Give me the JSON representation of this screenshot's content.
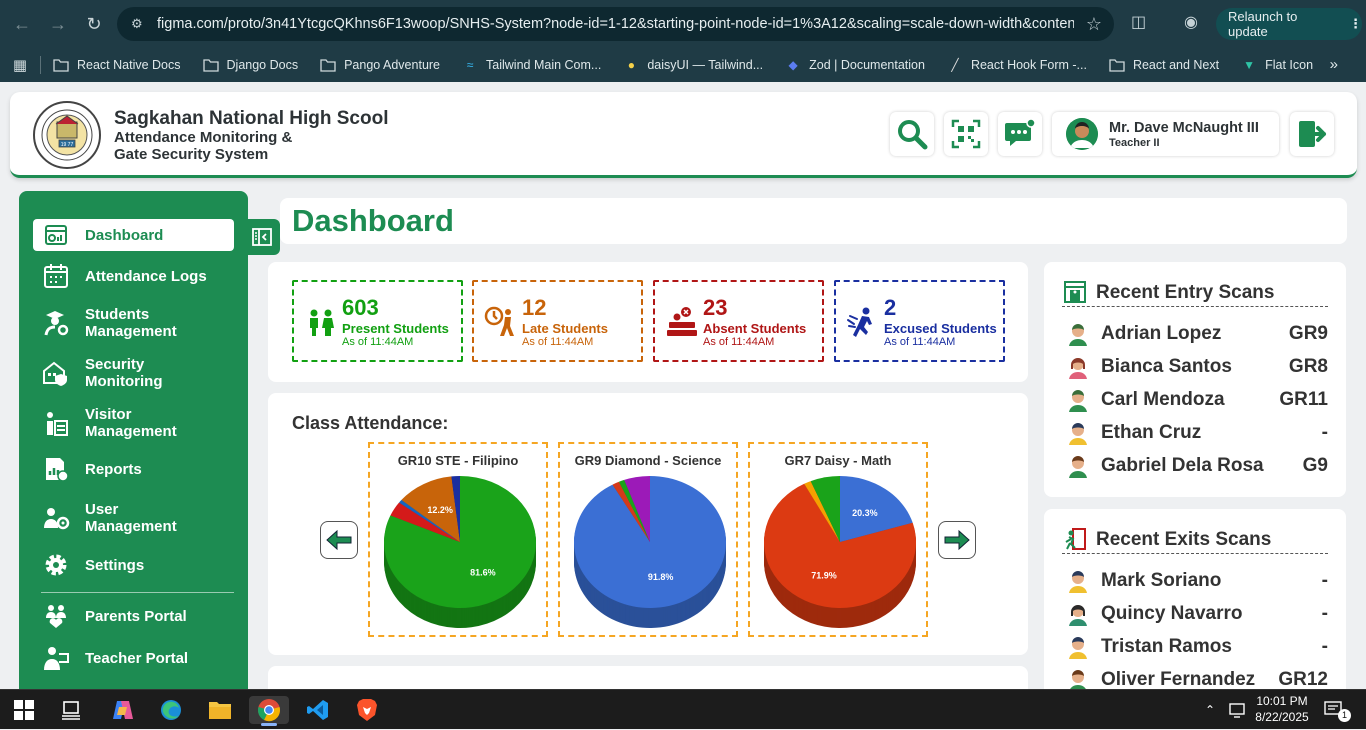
{
  "browser": {
    "url": "figma.com/proto/3n41YtcgcQKhns6F13woop/SNHS-System?node-id=1-12&starting-point-node-id=1%3A12&scaling=scale-down-width&conten...",
    "relaunch_label": "Relaunch to update",
    "bookmarks": [
      {
        "label": "React Native Docs",
        "icon": "folder-icon"
      },
      {
        "label": "Django Docs",
        "icon": "folder-icon"
      },
      {
        "label": "Pango Adventure",
        "icon": "folder-icon"
      },
      {
        "label": "Tailwind Main Com...",
        "icon": "tailwind-icon"
      },
      {
        "label": "daisyUI — Tailwind...",
        "icon": "daisyui-icon"
      },
      {
        "label": "Zod | Documentation",
        "icon": "zod-icon"
      },
      {
        "label": "React Hook Form -...",
        "icon": "rhf-icon"
      },
      {
        "label": "React and Next",
        "icon": "folder-icon"
      },
      {
        "label": "Flat Icon",
        "icon": "flaticon-icon"
      }
    ]
  },
  "header": {
    "school_name": "Sagkahan National High Scool",
    "system_line1": "Attendance Monitoring &",
    "system_line2": "Gate Security System",
    "user_name": "Mr. Dave McNaught III",
    "user_role": "Teacher II"
  },
  "sidebar": {
    "items": [
      {
        "label": "Dashboard",
        "icon": "dashboard-icon"
      },
      {
        "label": "Attendance Logs",
        "icon": "calendar-icon"
      },
      {
        "label": "Students Management",
        "icon": "student-gear-icon"
      },
      {
        "label": "Security Monitoring",
        "icon": "building-shield-icon"
      },
      {
        "label": "Visitor Management",
        "icon": "visitor-icon"
      },
      {
        "label": "Reports",
        "icon": "reports-icon"
      },
      {
        "label": "User Management",
        "icon": "users-gear-icon"
      },
      {
        "label": "Settings",
        "icon": "gear-icon"
      },
      {
        "label": "Parents Portal",
        "icon": "parents-icon"
      },
      {
        "label": "Teacher Portal",
        "icon": "teacher-icon"
      }
    ]
  },
  "main": {
    "page_title": "Dashboard",
    "stats": [
      {
        "value": "603",
        "label": "Present Students",
        "asof": "As of 11:44AM",
        "color": "#12a012"
      },
      {
        "value": "12",
        "label": "Late Students",
        "asof": "As of 11:44AM",
        "color": "#c8640a"
      },
      {
        "value": "23",
        "label": "Absent Students",
        "asof": "As of 11:44AM",
        "color": "#b01616"
      },
      {
        "value": "2",
        "label": "Excused Students",
        "asof": "As of 11:44AM",
        "color": "#1a2fa0"
      }
    ],
    "class_attendance_title": "Class Attendance:"
  },
  "chart_data": [
    {
      "type": "pie",
      "title": "GR10 STE - Filipino",
      "slices": [
        {
          "value": 81.6,
          "label": "81.6%",
          "color": "#1aa31a"
        },
        {
          "value": 3.6,
          "label": "",
          "color": "#d41a1a"
        },
        {
          "value": 0.8,
          "label": "",
          "color": "#1565c0"
        },
        {
          "value": 12.2,
          "label": "12.2%",
          "color": "#c8640a"
        },
        {
          "value": 1.8,
          "label": "",
          "color": "#1a2fa0"
        }
      ]
    },
    {
      "type": "pie",
      "title": "GR9 Diamond - Science",
      "slices": [
        {
          "value": 91.8,
          "label": "91.8%",
          "color": "#3b6fd4"
        },
        {
          "value": 1.5,
          "label": "",
          "color": "#d43a1a"
        },
        {
          "value": 1.2,
          "label": "",
          "color": "#1aa31a"
        },
        {
          "value": 5.5,
          "label": "",
          "color": "#9c1ab8"
        }
      ]
    },
    {
      "type": "pie",
      "title": "GR7 Daisy - Math",
      "slices": [
        {
          "value": 20.3,
          "label": "20.3%",
          "color": "#3b6fd4"
        },
        {
          "value": 71.9,
          "label": "71.9%",
          "color": "#dc3a12"
        },
        {
          "value": 1.5,
          "label": "",
          "color": "#f5a000"
        },
        {
          "value": 6.3,
          "label": "",
          "color": "#1aa31a"
        }
      ]
    }
  ],
  "entry_scans": {
    "title": "Recent Entry Scans",
    "rows": [
      {
        "name": "Adrian Lopez",
        "grade": "GR9"
      },
      {
        "name": "Bianca Santos",
        "grade": "GR8"
      },
      {
        "name": "Carl Mendoza",
        "grade": "GR11"
      },
      {
        "name": "Ethan Cruz",
        "grade": "-"
      },
      {
        "name": "Gabriel Dela Rosa",
        "grade": "G9"
      }
    ]
  },
  "exit_scans": {
    "title": "Recent Exits Scans",
    "rows": [
      {
        "name": "Mark Soriano",
        "grade": "-"
      },
      {
        "name": "Quincy Navarro",
        "grade": "-"
      },
      {
        "name": "Tristan Ramos",
        "grade": "-"
      },
      {
        "name": "Oliver Fernandez",
        "grade": "GR12"
      }
    ]
  },
  "taskbar": {
    "time": "10:01 PM",
    "date": "8/22/2025",
    "notif_count": "1"
  },
  "colors": {
    "brand_green": "#1d8c52",
    "present": "#12a012",
    "late": "#c8640a",
    "absent": "#b01616",
    "excused": "#1a2fa0"
  }
}
